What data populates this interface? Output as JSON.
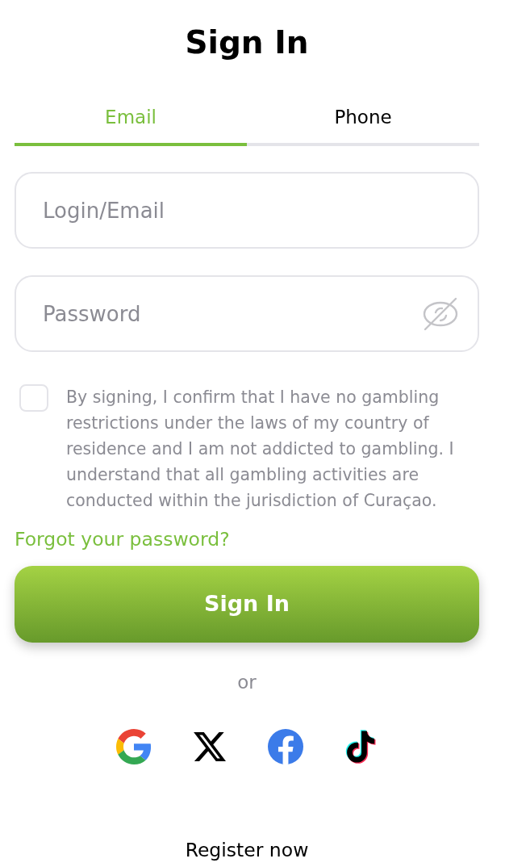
{
  "title": "Sign In",
  "tabs": [
    {
      "label": "Email",
      "selected": true
    },
    {
      "label": "Phone",
      "selected": false
    }
  ],
  "fields": [
    {
      "kind": "text",
      "placeholder": "Login/Email"
    },
    {
      "kind": "password",
      "placeholder": "Password"
    }
  ],
  "consent": {
    "checked": false,
    "text": "By signing, I confirm that I have no gambling restrictions under the laws of my country of residence and I am not addicted to gambling. I understand that all gambling activities are conducted within the jurisdiction of Curaçao."
  },
  "forgot_link": "Forgot your password?",
  "submit_button": "Sign In",
  "divider_text": "or",
  "social_logins": [
    {
      "kind": "google"
    },
    {
      "kind": "x"
    },
    {
      "kind": "facebook"
    },
    {
      "kind": "tiktok"
    }
  ],
  "register_link": "Register now"
}
